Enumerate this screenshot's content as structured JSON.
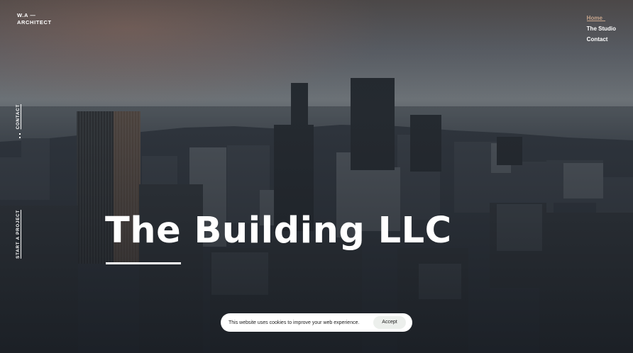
{
  "logo": {
    "line1": "W.A —",
    "line2": "ARCHITECT"
  },
  "nav": {
    "items": [
      {
        "label": "Home",
        "active": true
      },
      {
        "label": "The Studio"
      },
      {
        "label": "Contact"
      }
    ]
  },
  "side": {
    "contact": "Contact",
    "start_project": "Start a project"
  },
  "hero": {
    "title": "The Building LLC"
  },
  "cookie": {
    "message": "This website uses cookies to improve your web experience.",
    "accept_label": "Accept"
  },
  "colors": {
    "accent": "#c7a58c",
    "banner_bg": "#ffffff",
    "accept_bg": "#ecefec"
  }
}
